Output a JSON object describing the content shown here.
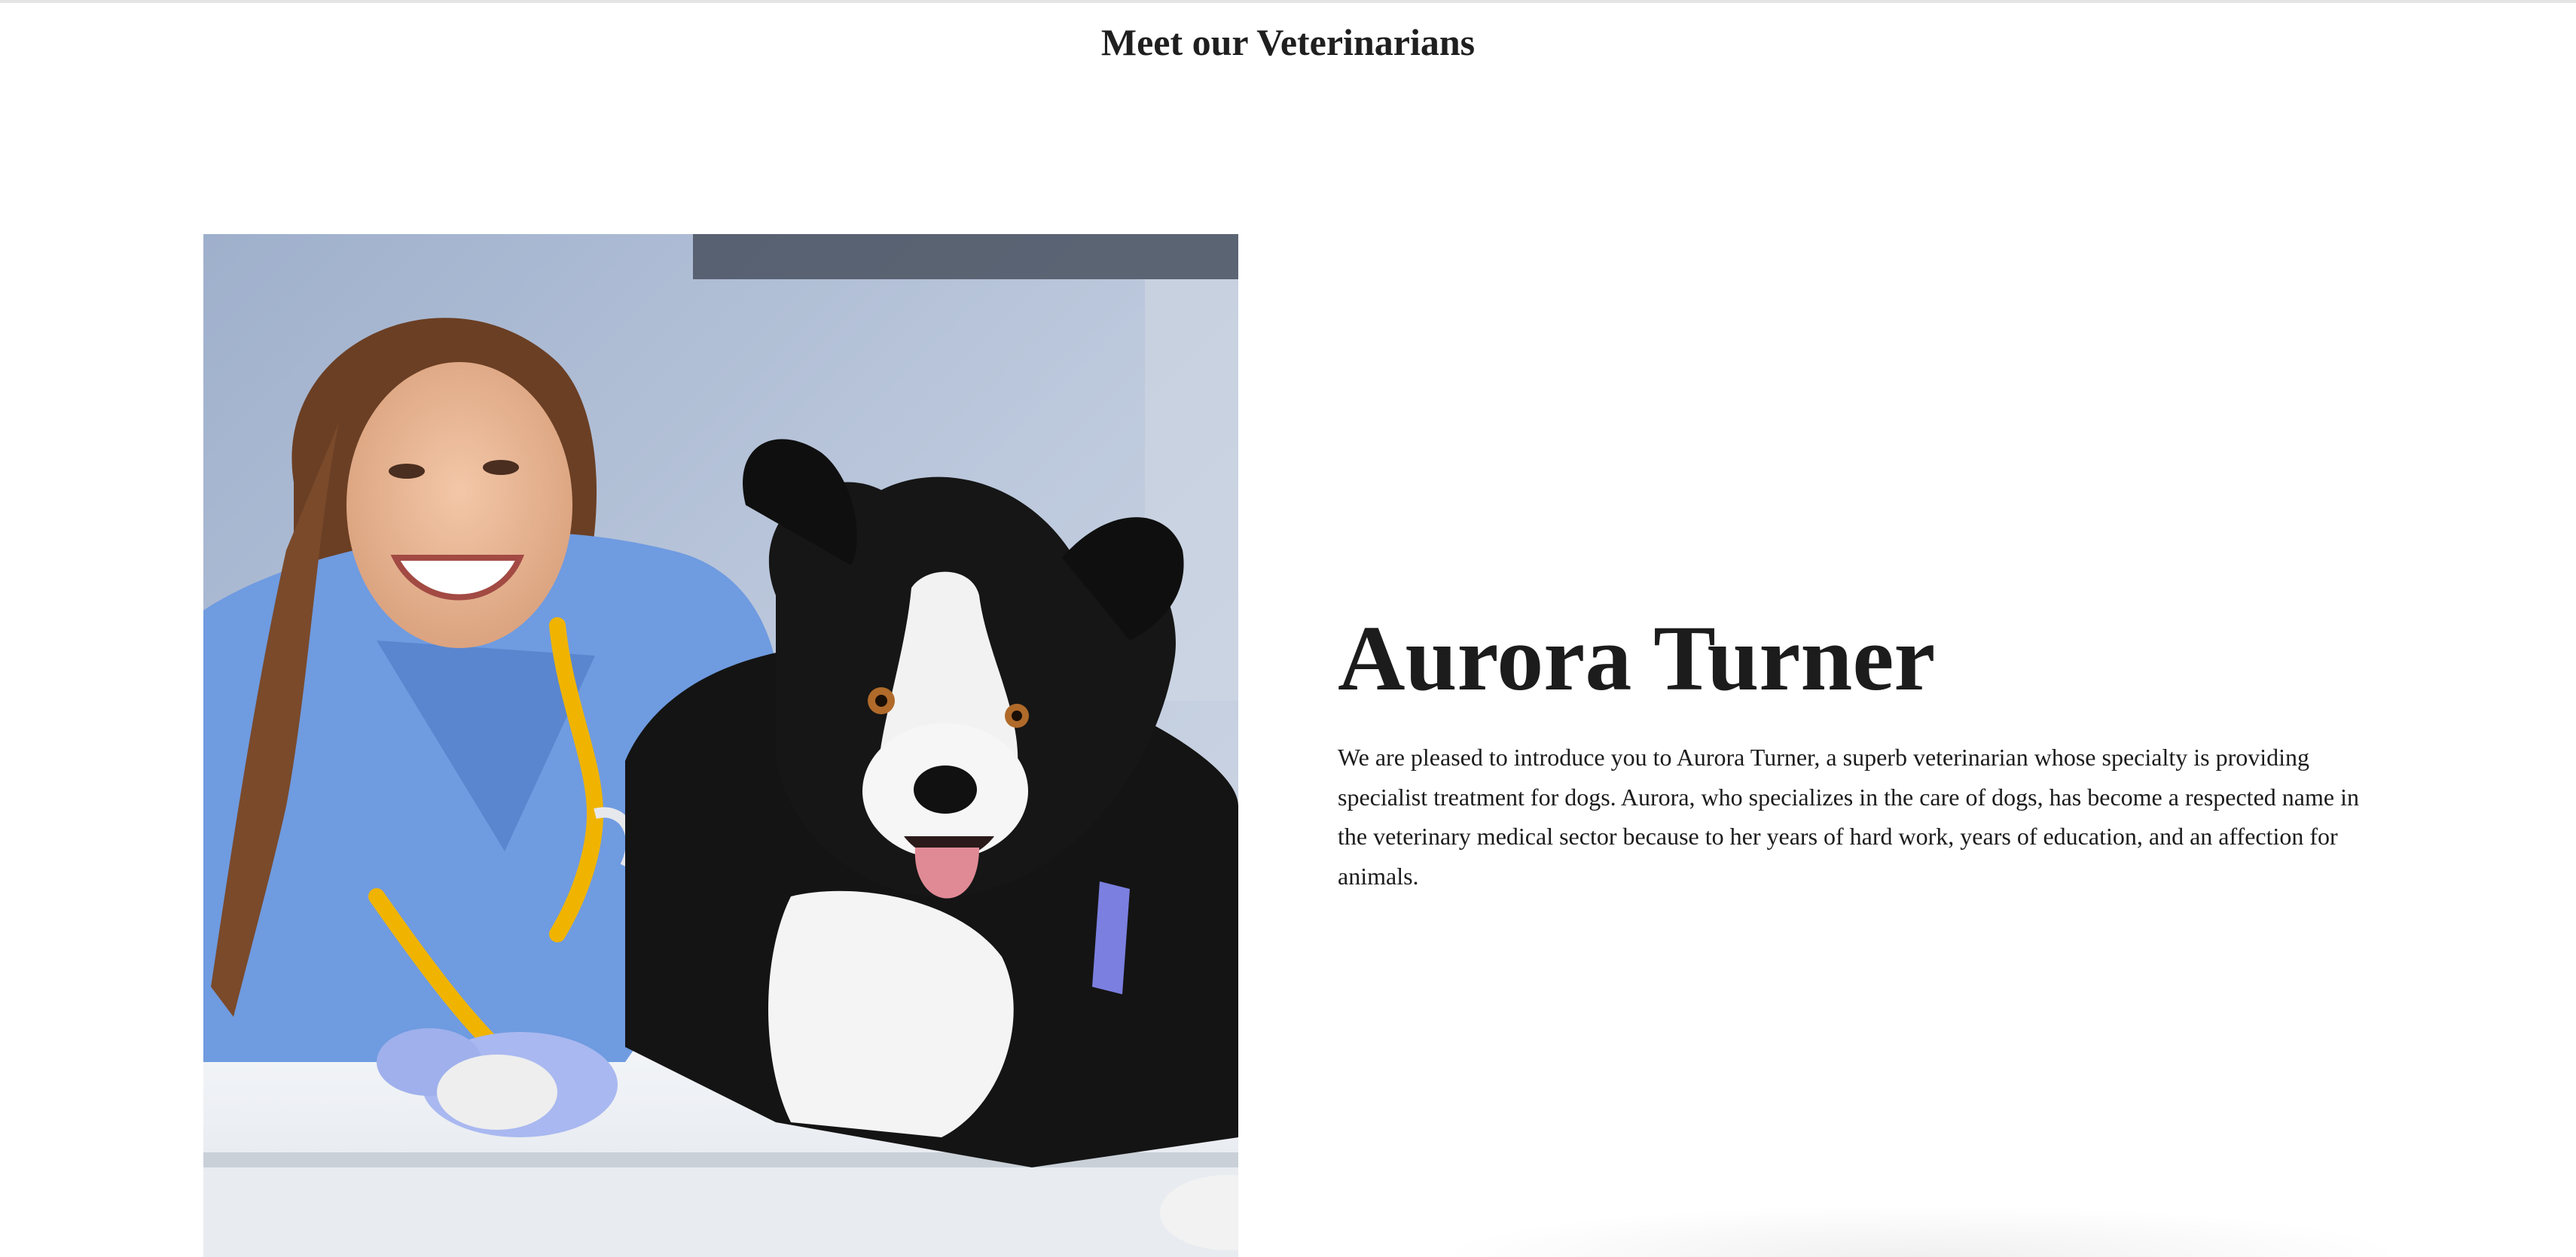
{
  "section": {
    "heading": "Meet our Veterinarians"
  },
  "veterinarian": {
    "name": "Aurora Turner",
    "bio": "We are pleased to introduce you to Aurora Turner, a superb veterinarian whose specialty is providing specialist treatment for dogs. Aurora, who specializes in the care of dogs, has become a respected name in the veterinary medical sector because to her years of hard work, years of education, and an affection for animals."
  },
  "colors": {
    "background": "#ffffff",
    "text": "#1f1f1f",
    "scrubs": "#6f9be0",
    "stethoscope": "#f0b400",
    "photo_backdrop": "#b7c3d8"
  }
}
